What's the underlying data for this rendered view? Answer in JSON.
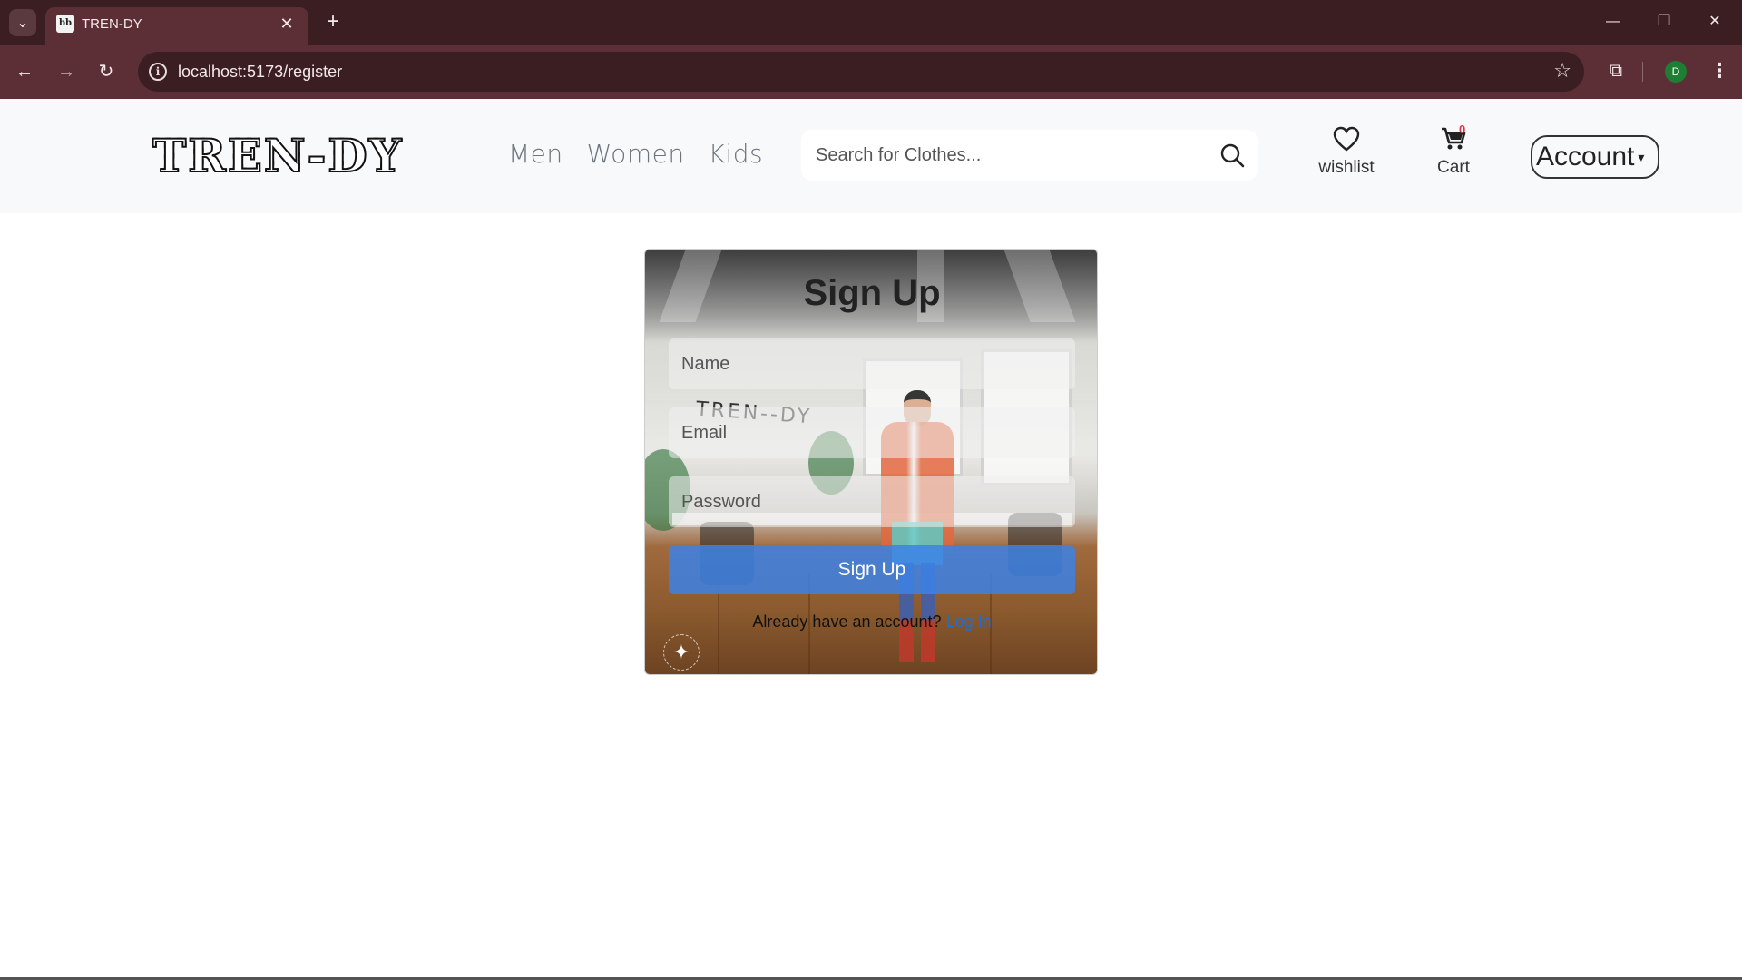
{
  "browser": {
    "tab": {
      "title": "TREN-DY",
      "favicon_text": "bb"
    },
    "url": "localhost:5173/register",
    "profile_initial": "D",
    "icons": {
      "tab_dropdown": "chevron-down-icon",
      "tab_close": "close-icon",
      "new_tab": "plus-icon",
      "back": "arrow-left-icon",
      "forward": "arrow-right-icon",
      "reload": "reload-icon",
      "site_info": "info-icon",
      "bookmark": "star-icon",
      "extensions": "puzzle-icon",
      "menu": "kebab-menu-icon",
      "minimize": "minimize-icon",
      "restore": "restore-icon",
      "close_window": "close-icon"
    },
    "glyphs": {
      "chevron_down": "⌄",
      "close": "✕",
      "plus": "+",
      "back": "←",
      "forward": "→",
      "reload": "↻",
      "info": "i",
      "star": "☆",
      "puzzle": "⧉",
      "kebab": "⋮",
      "minimize": "—",
      "restore": "❐",
      "close_window": "✕"
    }
  },
  "header": {
    "logo_text": "TREN-DY",
    "nav": [
      "Men",
      "Women",
      "Kids"
    ],
    "search_placeholder": "Search for Clothes...",
    "wishlist_label": "wishlist",
    "cart_label": "Cart",
    "cart_count": "0",
    "account_label": "Account",
    "caret": "▾"
  },
  "signup": {
    "title": "Sign Up",
    "name_placeholder": "Name",
    "email_placeholder": "Email",
    "password_placeholder": "Password",
    "button_label": "Sign Up",
    "login_prompt": "Already have an account?",
    "login_link": "Log In",
    "background_brand": "TREN--DY",
    "sparkle_glyph": "✦"
  },
  "colors": {
    "tabbar_bg": "#3a1e22",
    "toolbar_bg": "#5c2f36",
    "header_bg": "#f8f9fa",
    "primary_button": "#3c82e6",
    "link": "#1a6fd8",
    "badge": "#dc3545"
  }
}
